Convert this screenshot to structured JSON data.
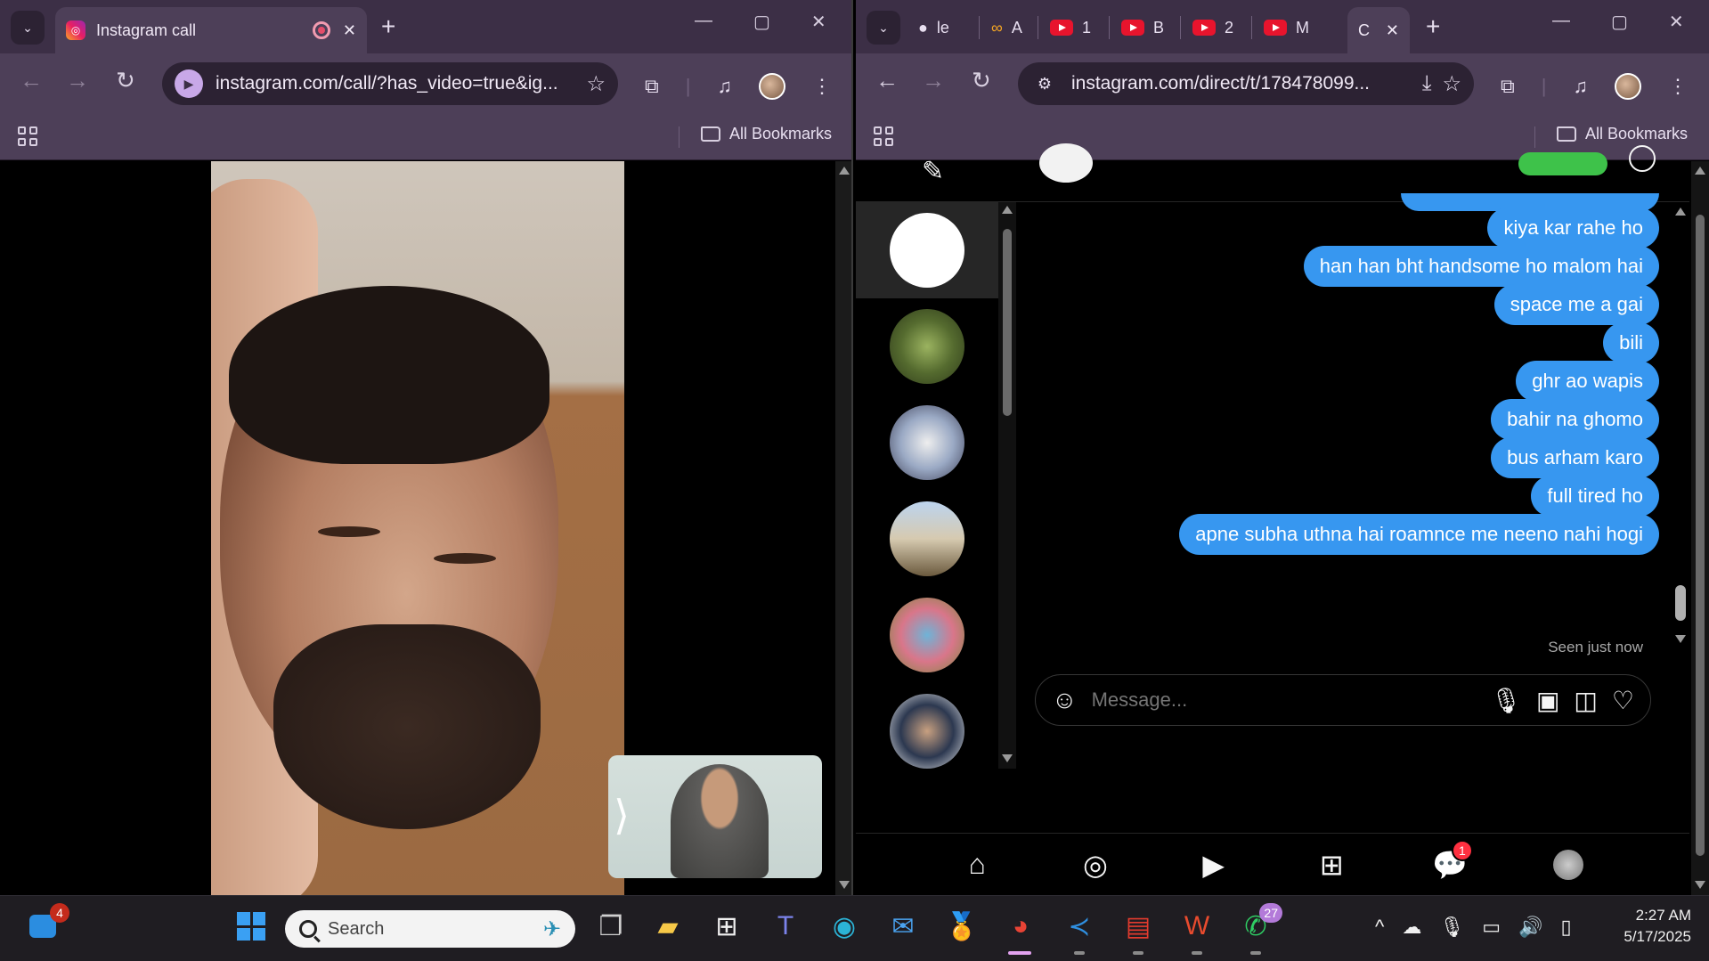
{
  "left_window": {
    "tab": {
      "title": "Instagram call"
    },
    "url": "instagram.com/call/?has_video=true&ig...",
    "bookmarks_label": "All Bookmarks"
  },
  "right_window": {
    "tabs": [
      {
        "label": "le",
        "icon": "github-icon"
      },
      {
        "label": "A",
        "icon": "infinity-icon"
      },
      {
        "label": "1",
        "icon": "youtube-icon"
      },
      {
        "label": "B",
        "icon": "youtube-icon"
      },
      {
        "label": "2",
        "icon": "youtube-icon"
      },
      {
        "label": "M",
        "icon": "youtube-icon"
      },
      {
        "label": "C",
        "icon": "active-tab"
      }
    ],
    "url": "instagram.com/direct/t/178478099...",
    "bookmarks_label": "All Bookmarks"
  },
  "chat": {
    "messages": [
      "kiya kar rahe ho",
      "han han bht handsome ho malom hai",
      "space me a gai",
      "bili",
      "ghr ao wapis",
      "bahir na ghomo",
      "bus arham karo",
      "full tired ho",
      "apne subha uthna hai roamnce me neeno nahi hogi"
    ],
    "seen_status": "Seen just now",
    "composer_placeholder": "Message...",
    "bubble_color": "#3797f0"
  },
  "conversations_count": 6,
  "ig_nav": {
    "items": [
      "home-icon",
      "explore-icon",
      "reels-icon",
      "create-icon",
      "messenger-icon",
      "profile-avatar"
    ],
    "messages_badge": "1"
  },
  "taskbar": {
    "widgets_badge": "4",
    "search_placeholder": "Search",
    "whatsapp_badge": "27",
    "time": "2:27 AM",
    "date": "5/17/2025"
  }
}
